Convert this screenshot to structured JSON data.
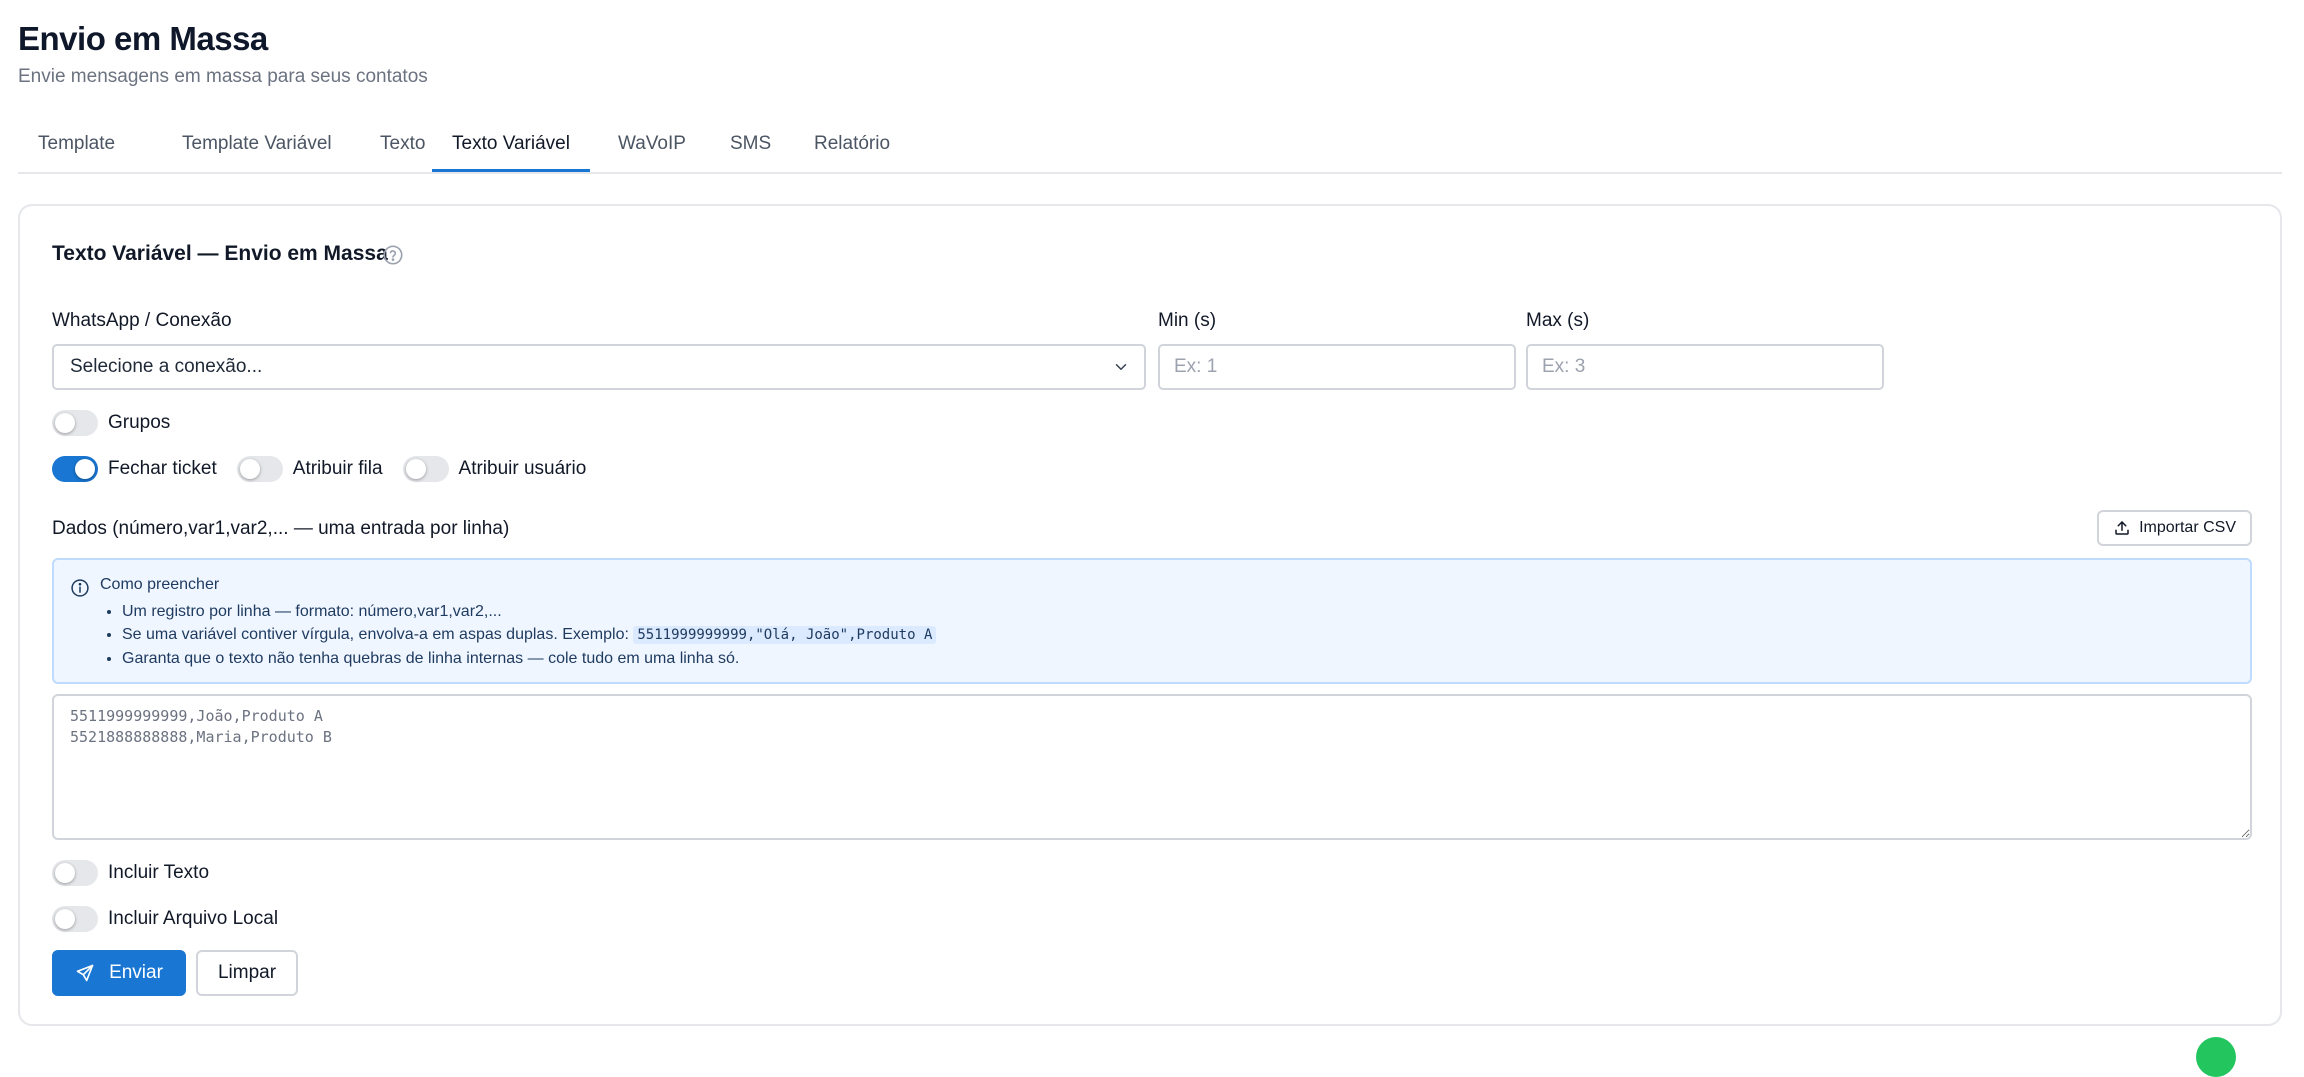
{
  "header": {
    "title": "Envio em Massa",
    "subtitle": "Envie mensagens em massa para seus contatos"
  },
  "tabs": [
    {
      "label": "Template",
      "active": false
    },
    {
      "label": "Template Variável",
      "active": false
    },
    {
      "label": "Texto",
      "active": false
    },
    {
      "label": "Texto Variável",
      "active": true
    },
    {
      "label": "WaVoIP",
      "active": false
    },
    {
      "label": "SMS",
      "active": false
    },
    {
      "label": "Relatório",
      "active": false
    }
  ],
  "form": {
    "title": "Texto Variável — Envio em Massa",
    "help_icon": "help-circle-icon",
    "connection": {
      "label": "WhatsApp / Conexão",
      "value": "Selecione a conexão...",
      "icon": "chevron-down-icon"
    },
    "min": {
      "label": "Min (s)",
      "placeholder": "Ex: 1"
    },
    "max": {
      "label": "Max (s)",
      "placeholder": "Ex: 3"
    },
    "toggles": {
      "grupos": {
        "label": "Grupos",
        "on": false
      },
      "fechar_ticket": {
        "label": "Fechar ticket",
        "on": true
      },
      "atribuir_fila": {
        "label": "Atribuir fila",
        "on": false
      },
      "atribuir_usuario": {
        "label": "Atribuir usuário",
        "on": false
      },
      "incluir_texto": {
        "label": "Incluir Texto",
        "on": false
      },
      "incluir_arquivo": {
        "label": "Incluir Arquivo Local",
        "on": false
      }
    },
    "data_label": "Dados (número,var1,var2,... — uma entrada por linha)",
    "import_button": {
      "label": "Importar CSV",
      "icon": "upload-icon"
    },
    "info": {
      "icon": "info-icon",
      "title": "Como preencher",
      "line1": "Um registro por linha — formato: número,var1,var2,...",
      "line2_prefix": "Se uma variável contiver vírgula, envolva-a em aspas duplas. Exemplo:",
      "line2_code": "5511999999999,\"Olá, João\",Produto A",
      "line3": "Garanta que o texto não tenha quebras de linha internas — cole tudo em uma linha só."
    },
    "data_placeholder": "5511999999999,João,Produto A\n5521888888888,Maria,Produto B",
    "buttons": {
      "send": {
        "label": "Enviar",
        "icon": "send-icon"
      },
      "clear": {
        "label": "Limpar"
      }
    }
  },
  "colors": {
    "accent": "#1976d2",
    "info_bg": "#eff6ff",
    "info_border": "#bfdbfe",
    "border": "#d1d5db"
  }
}
